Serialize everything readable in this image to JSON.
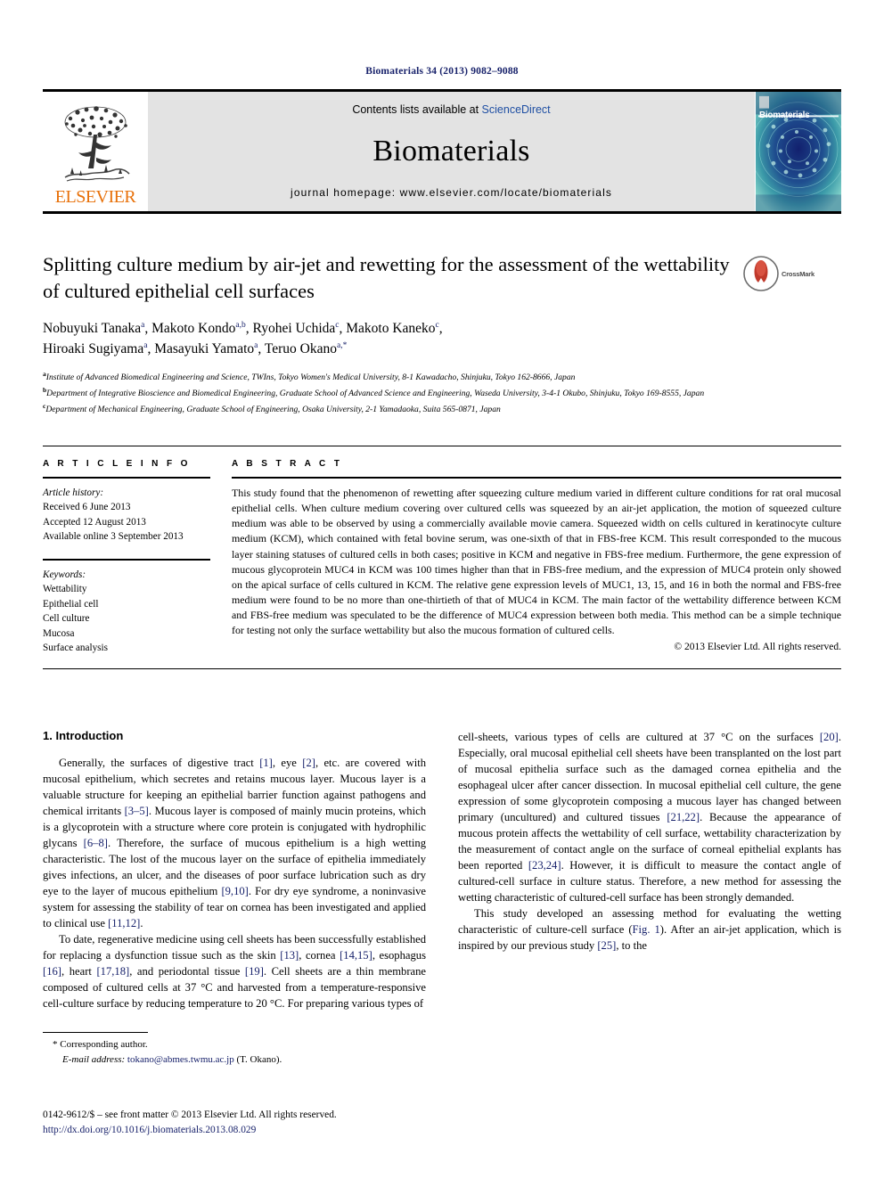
{
  "running_head": "Biomaterials 34 (2013) 9082–9088",
  "masthead": {
    "publisher_name": "ELSEVIER",
    "contents_prefix": "Contents lists available at ",
    "contents_link": "ScienceDirect",
    "journal_name": "Biomaterials",
    "homepage": "journal homepage: www.elsevier.com/locate/biomaterials",
    "cover_title": "Biomaterials"
  },
  "article": {
    "title": "Splitting culture medium by air-jet and rewetting for the assessment of the wettability of cultured epithelial cell surfaces",
    "crossmark_label": "CrossMark",
    "authors_line1_parts": [
      {
        "name": "Nobuyuki Tanaka",
        "sup": "a"
      },
      {
        "name": "Makoto Kondo",
        "sup": "a,b"
      },
      {
        "name": "Ryohei Uchida",
        "sup": "c"
      },
      {
        "name": "Makoto Kaneko",
        "sup": "c"
      }
    ],
    "authors_line2_parts": [
      {
        "name": "Hiroaki Sugiyama",
        "sup": "a"
      },
      {
        "name": "Masayuki Yamato",
        "sup": "a"
      },
      {
        "name": "Teruo Okano",
        "sup": "a,*"
      }
    ],
    "affiliations": [
      {
        "mark": "a",
        "text": "Institute of Advanced Biomedical Engineering and Science, TWIns, Tokyo Women's Medical University, 8-1 Kawadacho, Shinjuku, Tokyo 162-8666, Japan"
      },
      {
        "mark": "b",
        "text": "Department of Integrative Bioscience and Biomedical Engineering, Graduate School of Advanced Science and Engineering, Waseda University, 3-4-1 Okubo, Shinjuku, Tokyo 169-8555, Japan"
      },
      {
        "mark": "c",
        "text": "Department of Mechanical Engineering, Graduate School of Engineering, Osaka University, 2-1 Yamadaoka, Suita 565-0871, Japan"
      }
    ]
  },
  "article_info": {
    "heading": "A R T I C L E   I N F O",
    "history_label": "Article history:",
    "history": [
      "Received 6 June 2013",
      "Accepted 12 August 2013",
      "Available online 3 September 2013"
    ],
    "keywords_label": "Keywords:",
    "keywords": [
      "Wettability",
      "Epithelial cell",
      "Cell culture",
      "Mucosa",
      "Surface analysis"
    ]
  },
  "abstract": {
    "heading": "A B S T R A C T",
    "text": "This study found that the phenomenon of rewetting after squeezing culture medium varied in different culture conditions for rat oral mucosal epithelial cells. When culture medium covering over cultured cells was squeezed by an air-jet application, the motion of squeezed culture medium was able to be observed by using a commercially available movie camera. Squeezed width on cells cultured in keratinocyte culture medium (KCM), which contained with fetal bovine serum, was one-sixth of that in FBS-free KCM. This result corresponded to the mucous layer staining statuses of cultured cells in both cases; positive in KCM and negative in FBS-free medium. Furthermore, the gene expression of mucous glycoprotein MUC4 in KCM was 100 times higher than that in FBS-free medium, and the expression of MUC4 protein only showed on the apical surface of cells cultured in KCM. The relative gene expression levels of MUC1, 13, 15, and 16 in both the normal and FBS-free medium were found to be no more than one-thirtieth of that of MUC4 in KCM. The main factor of the wettability difference between KCM and FBS-free medium was speculated to be the difference of MUC4 expression between both media. This method can be a simple technique for testing not only the surface wettability but also the mucous formation of cultured cells.",
    "copyright": "© 2013 Elsevier Ltd. All rights reserved."
  },
  "introduction": {
    "section_title": "1. Introduction",
    "paragraph_1_html": "Generally, the surfaces of digestive tract <span class=\"ref\">[1]</span>, eye <span class=\"ref\">[2]</span>, etc. are covered with mucosal epithelium, which secretes and retains mucous layer. Mucous layer is a valuable structure for keeping an epithelial barrier function against pathogens and chemical irritants <span class=\"ref\">[3&#8211;5]</span>. Mucous layer is composed of mainly mucin proteins, which is a glycoprotein with a structure where core protein is conjugated with hydrophilic glycans <span class=\"ref\">[6&#8211;8]</span>. Therefore, the surface of mucous epithelium is a high wetting characteristic. The lost of the mucous layer on the surface of epithelia immediately gives infections, an ulcer, and the diseases of poor surface lubrication such as dry eye to the layer of mucous epithelium <span class=\"ref\">[9,10]</span>. For dry eye syndrome, a noninvasive system for assessing the stability of tear on cornea has been investigated and applied to clinical use <span class=\"ref\">[11,12]</span>.",
    "paragraph_2_html": "To date, regenerative medicine using cell sheets has been successfully established for replacing a dysfunction tissue such as the skin <span class=\"ref\">[13]</span>, cornea <span class=\"ref\">[14,15]</span>, esophagus <span class=\"ref\">[16]</span>, heart <span class=\"ref\">[17,18]</span>, and periodontal tissue <span class=\"ref\">[19]</span>. Cell sheets are a thin membrane composed of cultured cells at 37 &#176;C and harvested from a temperature-responsive cell-culture surface by reducing temperature to 20 &#176;C. For preparing various types of cell-sheets, various types of cells are cultured at 37 &#176;C on the surfaces <span class=\"ref\">[20]</span>. Especially, oral mucosal epithelial cell sheets have been transplanted on the lost part of mucosal epithelia surface such as the damaged cornea epithelia and the esophageal ulcer after cancer dissection. In mucosal epithelial cell culture, the gene expression of some glycoprotein composing a mucous layer has changed between primary (uncultured) and cultured tissues <span class=\"ref\">[21,22]</span>. Because the appearance of mucous protein affects the wettability of cell surface, wettability characterization by the measurement of contact angle on the surface of corneal epithelial explants has been reported <span class=\"ref\">[23,24]</span>. However, it is difficult to measure the contact angle of cultured-cell surface in culture status. Therefore, a new method for assessing the wetting characteristic of cultured-cell surface has been strongly demanded.",
    "paragraph_3_html": "This study developed an assessing method for evaluating the wetting characteristic of culture-cell surface (<span class=\"ref\">Fig. 1</span>). After an air-jet application, which is inspired by our previous study <span class=\"ref\">[25]</span>, to the"
  },
  "footnote": {
    "corresponding": "* Corresponding author.",
    "email_label": "E-mail address:",
    "email": "tokano@abmes.twmu.ac.jp",
    "email_suffix": "(T. Okano)."
  },
  "footer": {
    "front_matter": "0142-9612/$ – see front matter © 2013 Elsevier Ltd. All rights reserved.",
    "doi": "http://dx.doi.org/10.1016/j.biomaterials.2013.08.029"
  },
  "colors": {
    "link": "#18226b",
    "sciencedirect": "#1f4fa3",
    "elsevier_orange": "#e8710a",
    "masthead_gray": "#e3e3e3"
  }
}
